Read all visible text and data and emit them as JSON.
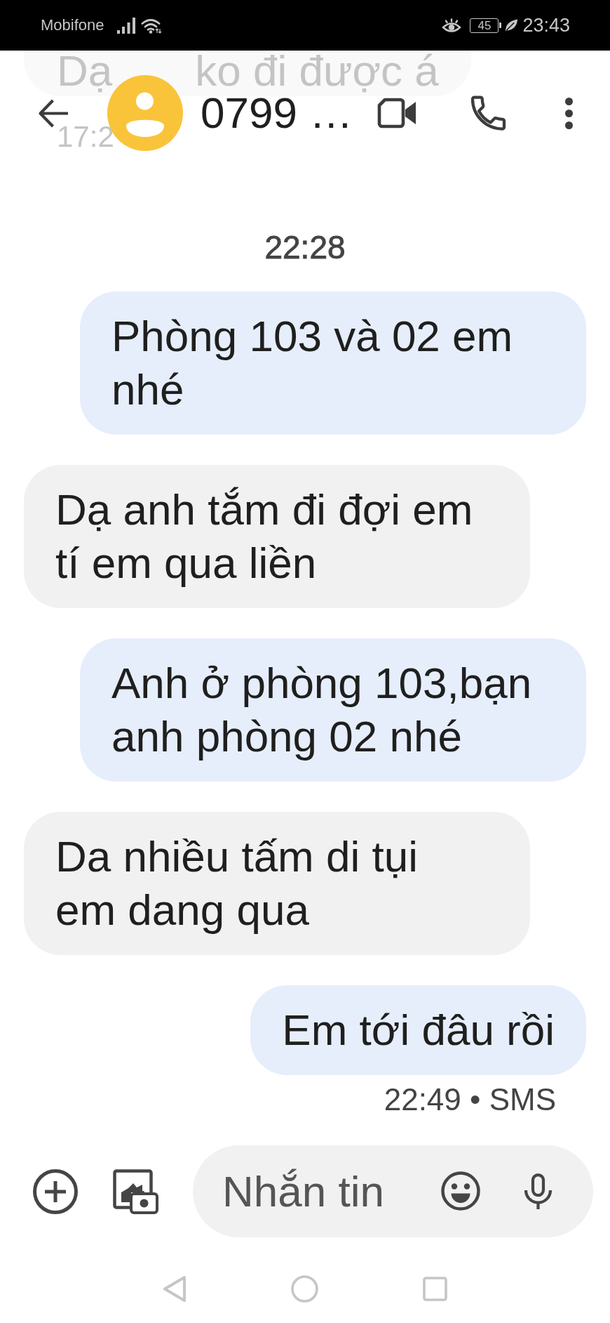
{
  "status_bar": {
    "carrier": "Mobifone",
    "battery": "45",
    "time": "23:43"
  },
  "header": {
    "faded_message": {
      "text_parts": [
        "Dạ",
        "ko đi được á"
      ],
      "time": "17:2"
    },
    "title": "0799 …"
  },
  "conversation": [
    {
      "kind": "timestamp",
      "text": "22:28"
    },
    {
      "kind": "sent",
      "text": "Phòng 103 và 02 em nhé"
    },
    {
      "kind": "received",
      "text": "Dạ anh tắm đi đợi em tí em qua liền"
    },
    {
      "kind": "sent",
      "text": "Anh ở phòng 103,bạn anh phòng 02 nhé"
    },
    {
      "kind": "received",
      "text": "Da nhiều tấm di tụi em dang qua"
    },
    {
      "kind": "sent",
      "text": "Em tới đâu rồi"
    },
    {
      "kind": "status",
      "text": "22:49 • SMS"
    }
  ],
  "composer": {
    "placeholder": "Nhắn tin"
  }
}
